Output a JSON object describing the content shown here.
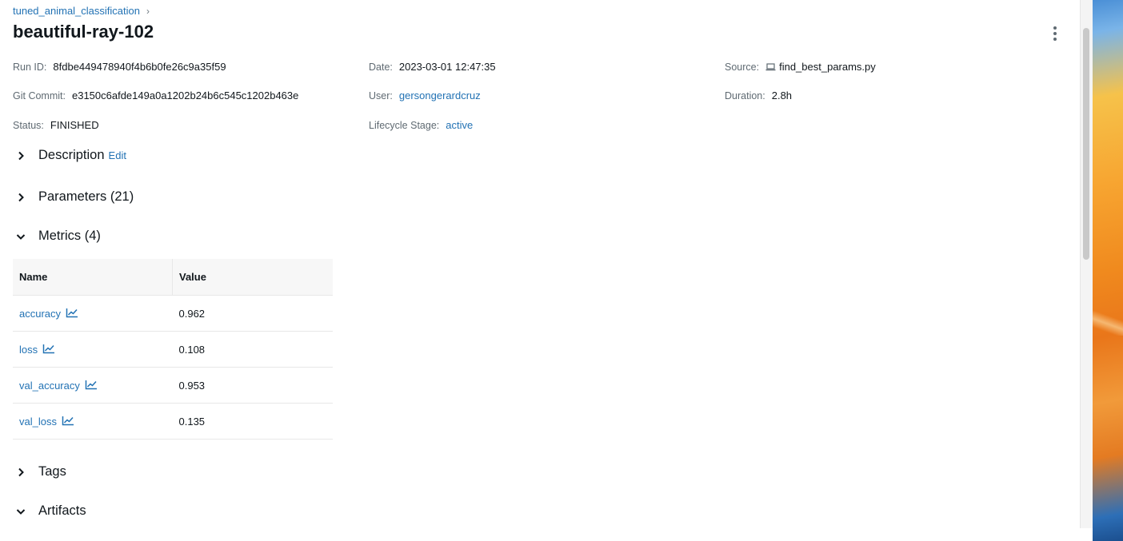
{
  "breadcrumb": {
    "experiment": "tuned_animal_classification",
    "separator": "›"
  },
  "run": {
    "title": "beautiful-ray-102"
  },
  "meta": {
    "run_id": {
      "label": "Run ID:",
      "value": "8fdbe449478940f4b6b0fe26c9a35f59"
    },
    "date": {
      "label": "Date:",
      "value": "2023-03-01 12:47:35"
    },
    "source": {
      "label": "Source:",
      "value": "find_best_params.py",
      "icon": "laptop-icon"
    },
    "git_commit": {
      "label": "Git Commit:",
      "value": "e3150c6afde149a0a1202b24b6c545c1202b463e"
    },
    "user": {
      "label": "User:",
      "value": "gersongerardcruz"
    },
    "duration": {
      "label": "Duration:",
      "value": "2.8h"
    },
    "status": {
      "label": "Status:",
      "value": "FINISHED"
    },
    "lifecycle": {
      "label": "Lifecycle Stage:",
      "value": "active"
    }
  },
  "sections": {
    "description": {
      "label": "Description",
      "edit": "Edit",
      "expanded": false
    },
    "parameters": {
      "label": "Parameters (21)",
      "expanded": false
    },
    "metrics": {
      "label": "Metrics (4)",
      "expanded": true
    },
    "tags": {
      "label": "Tags",
      "expanded": false
    },
    "artifacts": {
      "label": "Artifacts",
      "expanded": true
    }
  },
  "metrics_table": {
    "headers": {
      "name": "Name",
      "value": "Value"
    },
    "rows": [
      {
        "name": "accuracy",
        "value": "0.962"
      },
      {
        "name": "loss",
        "value": "0.108"
      },
      {
        "name": "val_accuracy",
        "value": "0.953"
      },
      {
        "name": "val_loss",
        "value": "0.135"
      }
    ]
  },
  "colors": {
    "link": "#2272b4",
    "text": "#11171c",
    "muted": "#5f6a72"
  }
}
